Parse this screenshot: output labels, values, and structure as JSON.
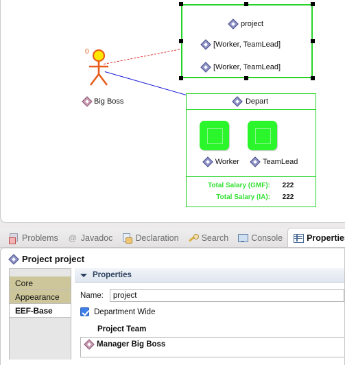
{
  "diagram": {
    "actor": {
      "multiplicity": "0",
      "label": "Big Boss",
      "icon": "actor-icon"
    },
    "project_node": {
      "title": "project",
      "rows": [
        "[Worker, TeamLead]",
        "[Worker, TeamLead]"
      ],
      "border_color": "#25d425",
      "selected": true
    },
    "depart_node": {
      "title": "Depart",
      "members": [
        "Worker",
        "TeamLead"
      ],
      "border_color": "#25d425",
      "box_color": "#2bf52b",
      "salaries": [
        {
          "label": "Total Salary (GMF):",
          "value": "222"
        },
        {
          "label": "Total Salary (IA):",
          "value": "222"
        }
      ],
      "salary_label_color": "#36e036"
    },
    "connectors": [
      {
        "name": "red-dashed-connector",
        "style": "dashed",
        "color": "#e03030"
      },
      {
        "name": "blue-solid-connector",
        "style": "solid",
        "color": "#1a18d8"
      }
    ]
  },
  "tabbar": {
    "tabs": [
      {
        "label": "Problems",
        "icon": "problems-icon",
        "active": false
      },
      {
        "label": "Javadoc",
        "icon": "javadoc-icon",
        "active": false
      },
      {
        "label": "Declaration",
        "icon": "declaration-icon",
        "active": false
      },
      {
        "label": "Search",
        "icon": "search-icon",
        "active": false
      },
      {
        "label": "Console",
        "icon": "console-icon",
        "active": false
      },
      {
        "label": "Properties",
        "icon": "properties-icon",
        "active": true
      }
    ],
    "overflow": "»"
  },
  "properties": {
    "title": "Project project",
    "tab_list": [
      {
        "label": "Core",
        "state": "tan"
      },
      {
        "label": "Appearance",
        "state": "tan"
      },
      {
        "label": "EEF-Base",
        "state": "selected"
      }
    ],
    "section": {
      "label": "Properties",
      "expanded": true
    },
    "name_field": {
      "label": "Name:",
      "value": "project",
      "placeholder": ""
    },
    "checkbox": {
      "label": "Department Wide",
      "checked": true
    },
    "group": {
      "label": "Project Team"
    },
    "list": [
      {
        "label": "Manager Big Boss",
        "icon": "diamond-pink-icon"
      }
    ]
  }
}
